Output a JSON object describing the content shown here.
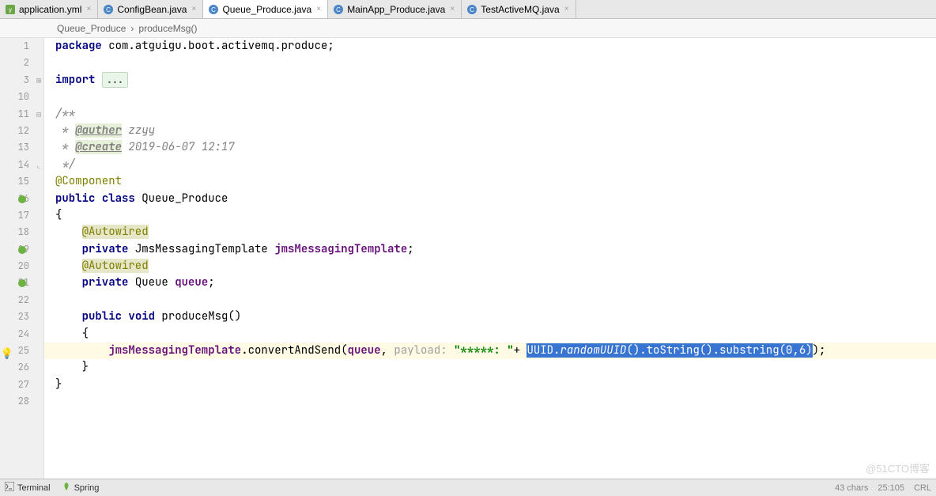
{
  "tabs": [
    {
      "label": "application.yml",
      "icon": "yml"
    },
    {
      "label": "ConfigBean.java",
      "icon": "java"
    },
    {
      "label": "Queue_Produce.java",
      "icon": "java",
      "active": true
    },
    {
      "label": "MainApp_Produce.java",
      "icon": "java"
    },
    {
      "label": "TestActiveMQ.java",
      "icon": "java"
    }
  ],
  "breadcrumb": {
    "class": "Queue_Produce",
    "sep": "›",
    "method": "produceMsg()"
  },
  "gutter_lines": [
    "1",
    "2",
    "3",
    "10",
    "11",
    "12",
    "13",
    "14",
    "15",
    "16",
    "17",
    "18",
    "19",
    "20",
    "21",
    "22",
    "23",
    "24",
    "25",
    "26",
    "27",
    "28"
  ],
  "code": {
    "pkg_kw": "package",
    "pkg_name": " com.atguigu.boot.activemq.produce;",
    "import_kw": "import",
    "import_fold": "...",
    "doc_open": "/**",
    "doc_auth_tag": "@auther",
    "doc_auth_val": " zzyy",
    "doc_create_tag": "@create",
    "doc_create_val": " 2019-06-07 12:17",
    "doc_close": " */",
    "ann_component": "@Component",
    "public_kw": "public",
    "class_kw": "class",
    "class_name": " Queue_Produce",
    "brace_open": "{",
    "ann_autowired": "@Autowired",
    "private_kw": "private",
    "jms_type": " JmsMessagingTemplate ",
    "jms_field": "jmsMessagingTemplate",
    "queue_type": " Queue ",
    "queue_field": "queue",
    "void_kw": "void",
    "method_name": " produceMsg()",
    "jms_call": "jmsMessagingTemplate",
    "convert_call": ".convertAndSend(",
    "queue_arg": "queue",
    "payload_hint": "payload:",
    "str_literal": "\"*****: \"",
    "plus": "+ ",
    "uuid_part1": "UUID.",
    "uuid_part2": "randomUUID",
    "uuid_part3": "().toString().substring(0,6)",
    "tail": ");",
    "brace_close": "}",
    "brace_close2": "}",
    "brace_inner_open": "{",
    "brace_inner_close": "}"
  },
  "bottom": {
    "terminal": "Terminal",
    "spring": "Spring",
    "chars": "43 chars",
    "pos": "25:105",
    "enc": "CRL"
  },
  "watermark": "@51CTO博客"
}
